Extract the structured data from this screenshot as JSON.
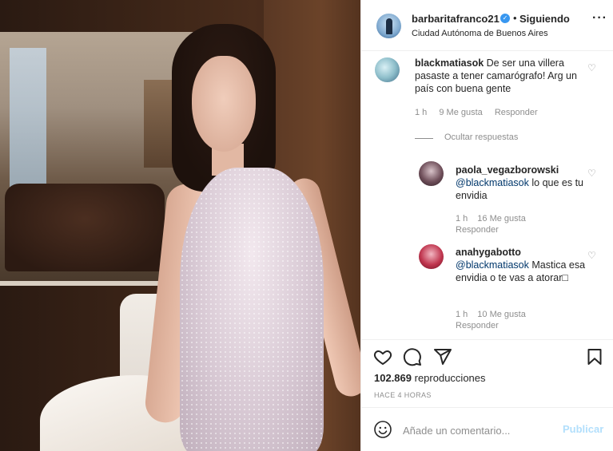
{
  "post": {
    "username": "barbaritafranco21",
    "follow_status": "Siguiendo",
    "separator": "•",
    "location": "Ciudad Autónoma de Buenos Aires",
    "more_glyph": "···"
  },
  "comment": {
    "username": "blackmatiasok",
    "text": "De ser una villera pasaste a tener camarógrafo! Arg un país con buena gente",
    "time": "1 h",
    "likes": "9 Me gusta",
    "reply": "Responder"
  },
  "hide_replies": "Ocultar respuestas",
  "replies": [
    {
      "username": "paola_vegazborowski",
      "mention": "@blackmatiasok",
      "text": "lo que es tu envidia",
      "time": "1 h",
      "likes": "16 Me gusta",
      "reply": "Responder"
    },
    {
      "username": "anahygabotto",
      "mention": "@blackmatiasok",
      "text": "Mastica esa envidia o te vas a atorar□",
      "time": "1 h",
      "likes": "10 Me gusta",
      "reply": "Responder"
    }
  ],
  "stats": {
    "views_count": "102.869",
    "views_label": "reproducciones",
    "posted": "HACE 4 HORAS"
  },
  "composer": {
    "placeholder": "Añade un comentario...",
    "publish": "Publicar"
  },
  "icons": {
    "verified": "verified-badge-icon",
    "like": "heart-icon",
    "comment": "comment-bubble-icon",
    "share": "paper-plane-icon",
    "save": "bookmark-icon",
    "emoji": "smiley-icon"
  },
  "colors": {
    "verified_blue": "#3897f0",
    "mention_blue": "#00376b",
    "secondary_text": "#8e8e8e",
    "publish_disabled": "#b2dffc"
  }
}
